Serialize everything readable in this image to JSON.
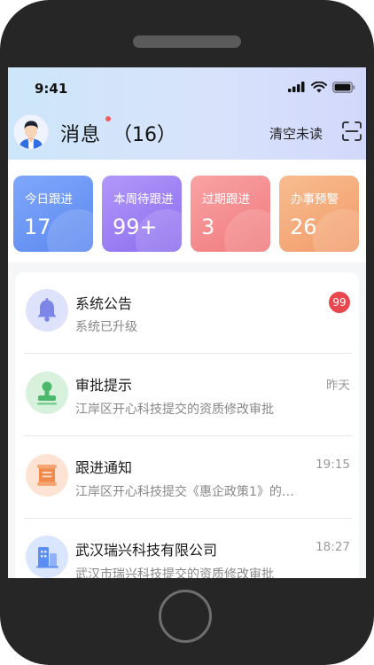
{
  "status_bar": {
    "time": "9:41"
  },
  "header": {
    "title": "消息",
    "unread_count": "（16）",
    "clear_unread": "清空未读"
  },
  "stats": [
    {
      "label": "今日跟进",
      "value": "17",
      "color": "#6b97f6"
    },
    {
      "label": "本周待跟进",
      "value": "99+",
      "color": "#9b7ef1"
    },
    {
      "label": "过期跟进",
      "value": "3",
      "color": "#f48b8e"
    },
    {
      "label": "办事预警",
      "value": "26",
      "color": "#f5ac7a"
    }
  ],
  "messages": [
    {
      "title": "系统公告",
      "subtitle": "系统已升级",
      "badge": "99",
      "time": "",
      "icon": "bell-icon",
      "icon_color": "#7b86e8"
    },
    {
      "title": "审批提示",
      "subtitle": "江岸区开心科技提交的资质修改审批",
      "time": "昨天",
      "icon": "stamp-icon",
      "icon_color": "#4cb86b"
    },
    {
      "title": "跟进通知",
      "subtitle": "江岸区开心科技提交《惠企政策1》的…",
      "time": "19:15",
      "icon": "scroll-icon",
      "icon_color": "#f08a4b"
    },
    {
      "title": "武汉瑞兴科技有限公司",
      "subtitle": "武汉市瑞兴科技提交的资质修改审批",
      "time": "18:27",
      "icon": "building-icon",
      "icon_color": "#5b8df3"
    }
  ]
}
